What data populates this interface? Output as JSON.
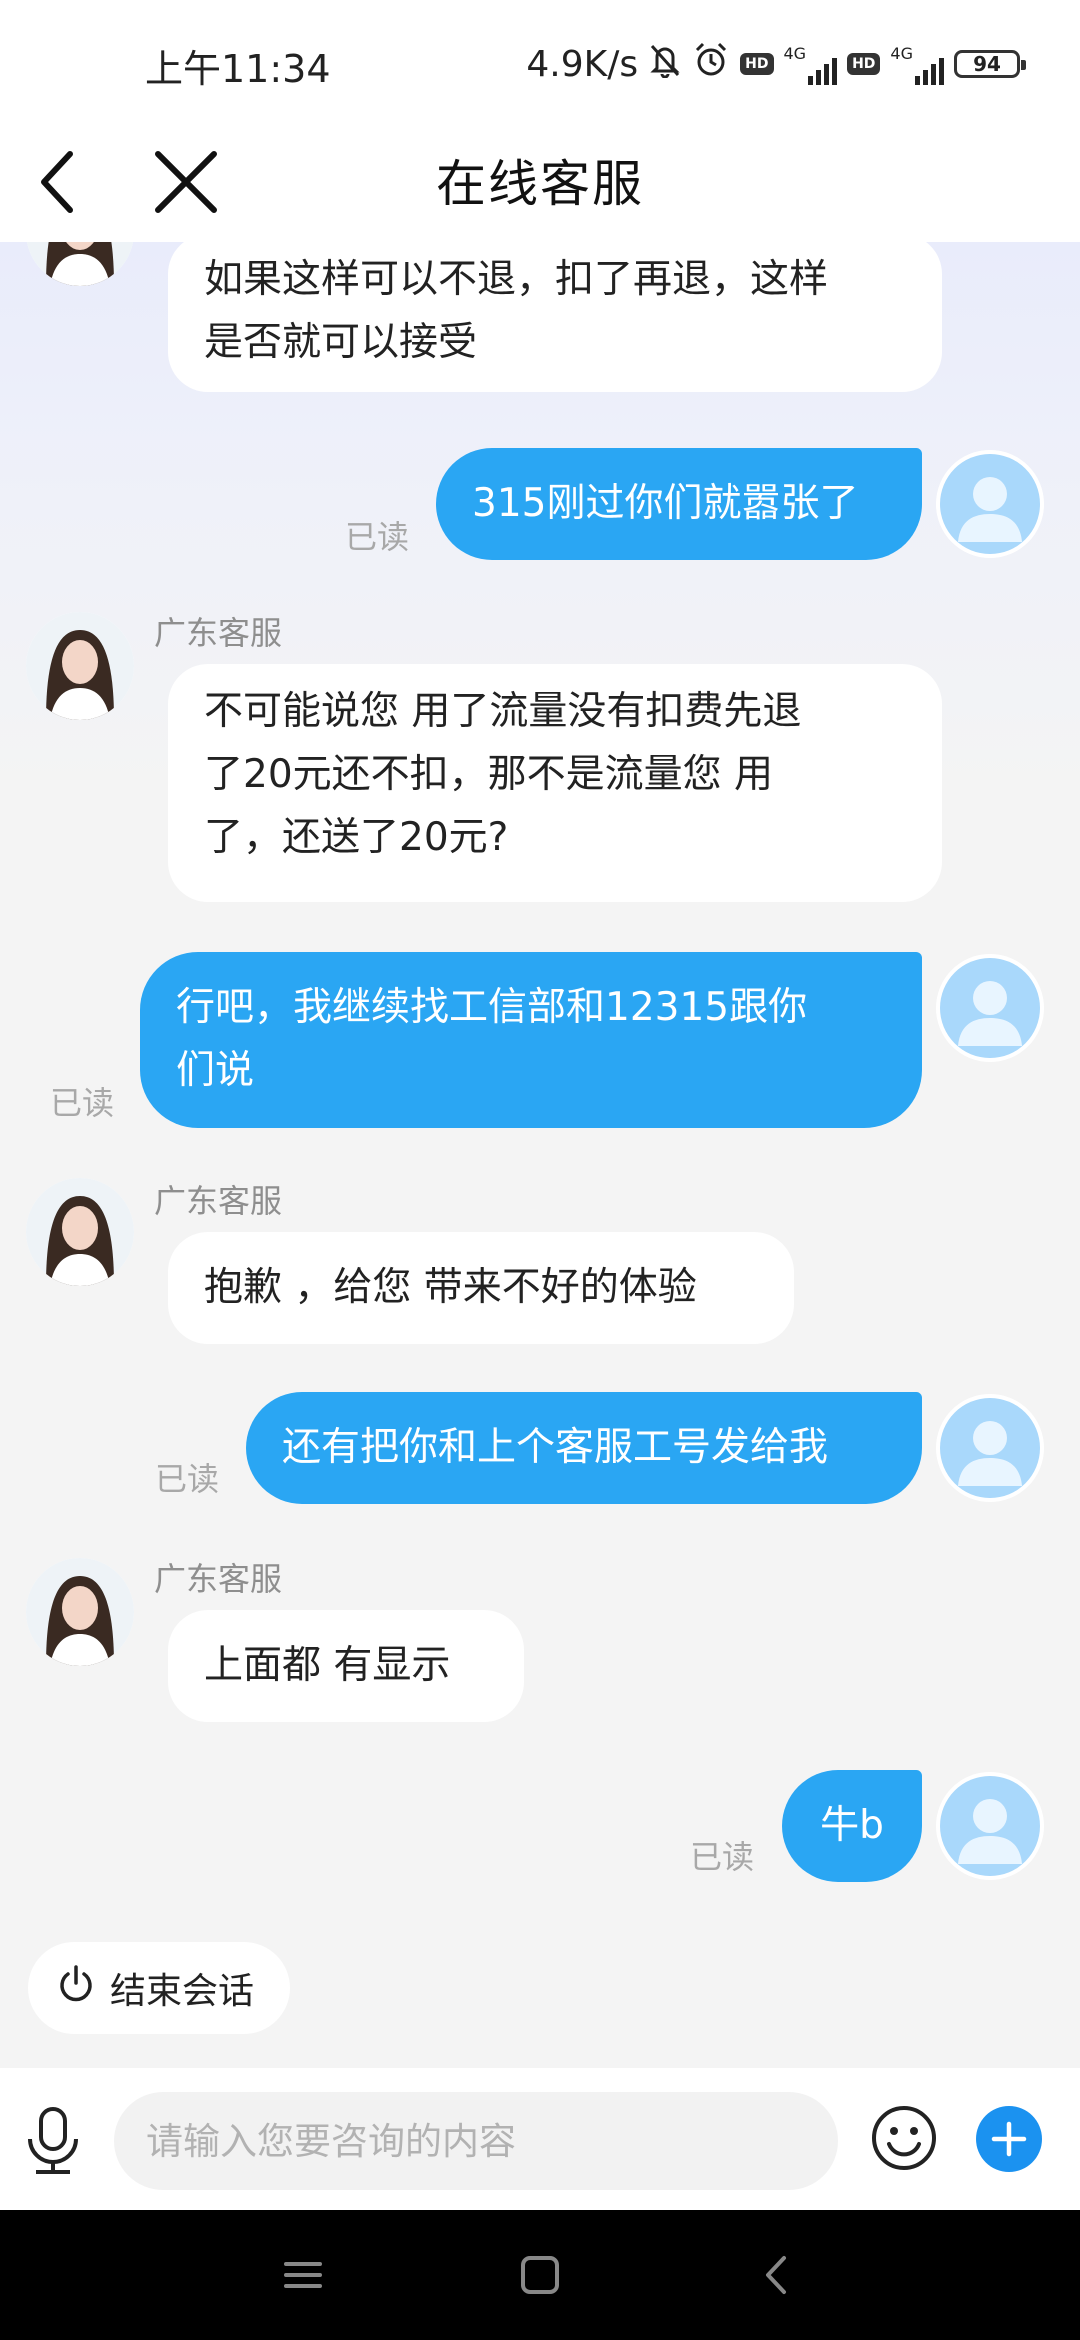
{
  "status_bar": {
    "time": "上午11:34",
    "net_speed": "4.9K/s",
    "hd_label": "HD",
    "network_type_1": "4G",
    "network_type_2": "4G",
    "battery": "94"
  },
  "header": {
    "title": "在线客服"
  },
  "messages": {
    "m1": {
      "lines": [
        "如果这样可以不退，扣了再退，这样",
        "是否就可以接受"
      ]
    },
    "m2": {
      "text": "315刚过你们就嚣张了",
      "status": "已读"
    },
    "m3": {
      "sender": "广东客服",
      "lines": [
        "不可能说您 用了流量没有扣费先退",
        "了20元还不扣，那不是流量您 用",
        "了，还送了20元?"
      ]
    },
    "m4": {
      "lines": [
        "行吧，我继续找工信部和12315跟你",
        "们说"
      ],
      "status": "已读"
    },
    "m5": {
      "sender": "广东客服",
      "text": "抱歉 ，给您 带来不好的体验"
    },
    "m6": {
      "text": "还有把你和上个客服工号发给我",
      "status": "已读"
    },
    "m7": {
      "sender": "广东客服",
      "text": "上面都 有显示"
    },
    "m8": {
      "text": "牛b",
      "status": "已读"
    }
  },
  "end_session": {
    "label": "结束会话"
  },
  "input": {
    "placeholder": "请输入您要咨询的内容"
  },
  "colors": {
    "outgoing_bubble": "#2aa6f3",
    "incoming_bubble": "#ffffff",
    "plus_button": "#1b92f0"
  },
  "icons": {
    "back": "chevron-left-icon",
    "close": "close-icon",
    "mic": "microphone-icon",
    "emoji": "smiley-icon",
    "plus": "plus-icon",
    "power": "power-icon",
    "alarm": "alarm-icon",
    "mute": "bell-off-icon"
  }
}
